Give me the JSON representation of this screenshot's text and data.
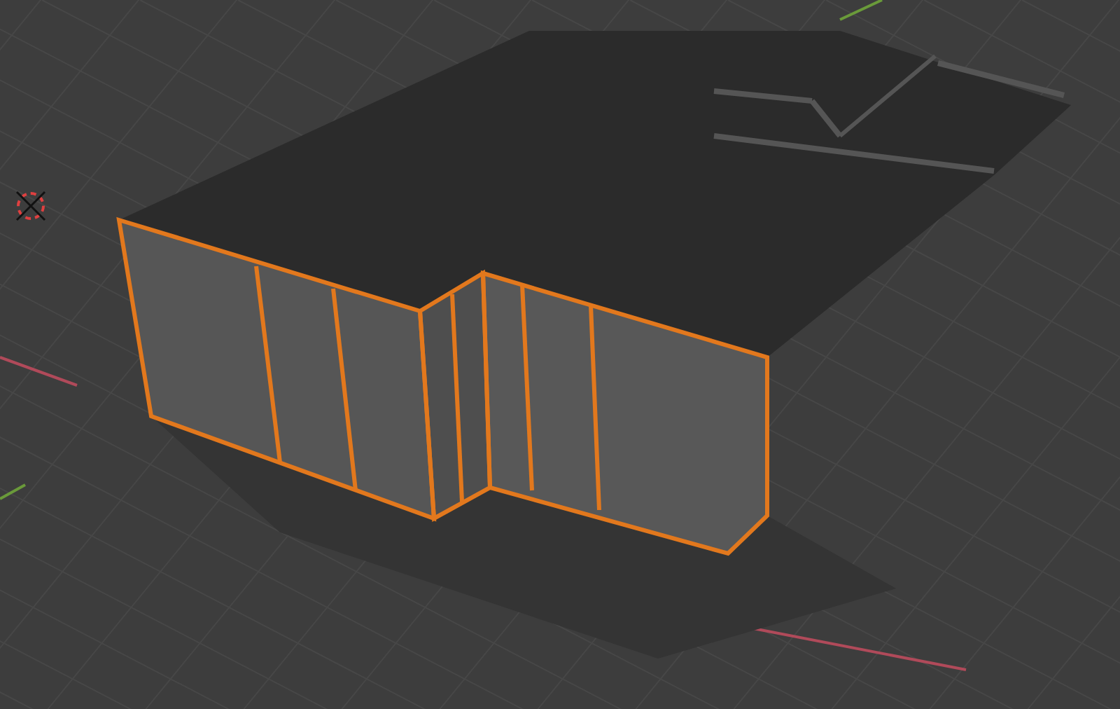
{
  "viewport": {
    "objects": [
      {
        "kind": "mesh",
        "selected": true
      }
    ],
    "cursor": {
      "kind": "cursor"
    }
  }
}
